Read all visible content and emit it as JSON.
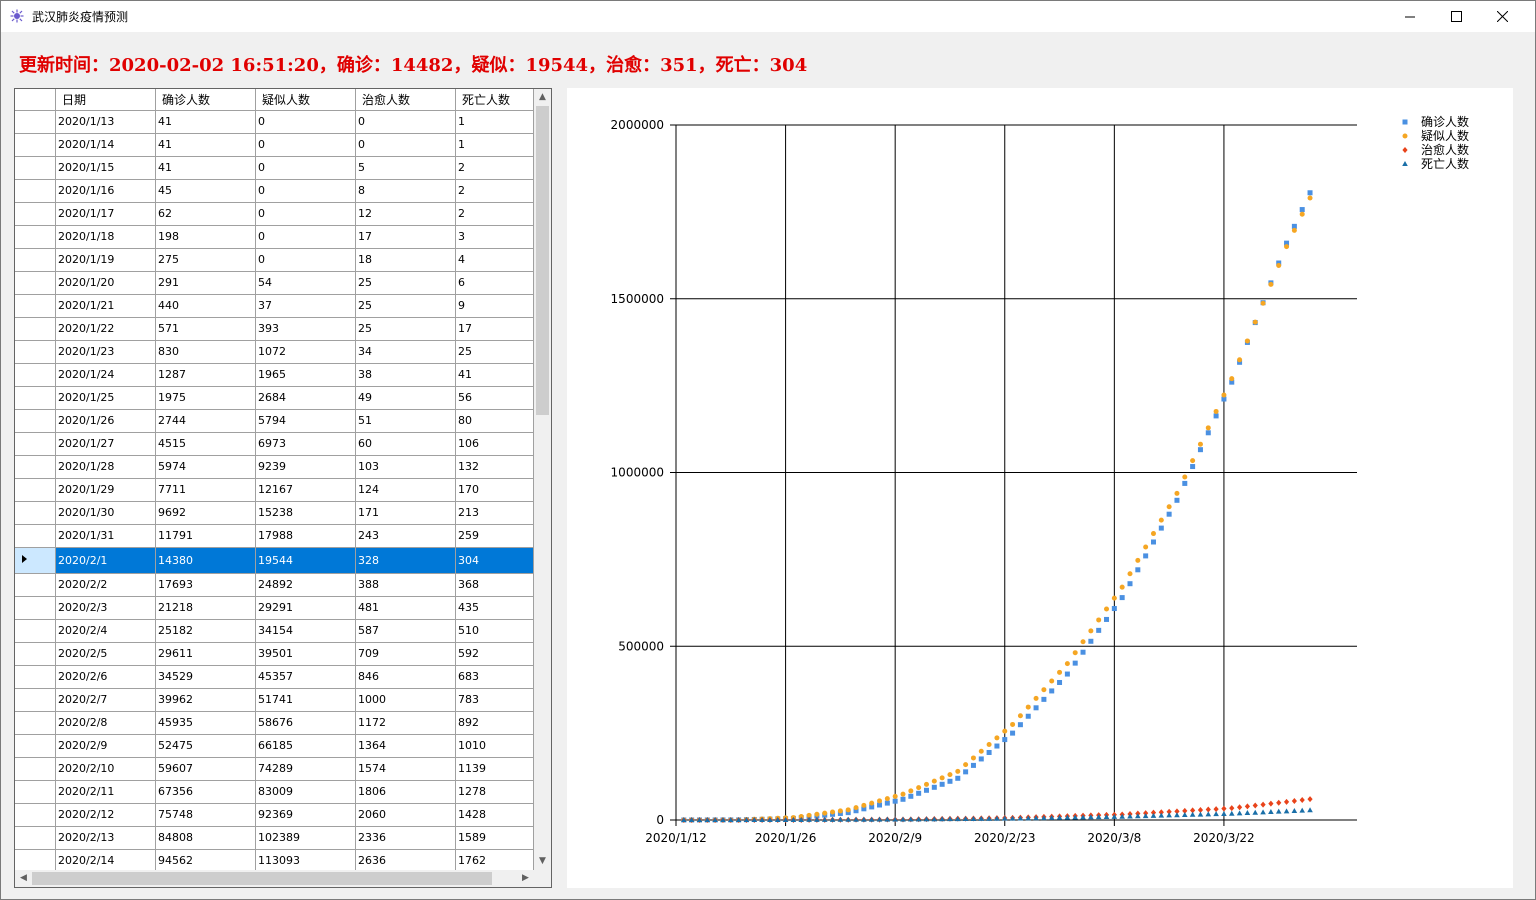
{
  "window": {
    "title": "武汉肺炎疫情预测"
  },
  "status_line": "更新时间：2020-02-02 16:51:20，确诊：14482，疑似：19544，治愈：351，死亡：304",
  "table": {
    "columns": [
      "日期",
      "确诊人数",
      "疑似人数",
      "治愈人数",
      "死亡人数"
    ],
    "selected_row": 19,
    "rows": [
      [
        "2020/1/13",
        "41",
        "0",
        "0",
        "1"
      ],
      [
        "2020/1/14",
        "41",
        "0",
        "0",
        "1"
      ],
      [
        "2020/1/15",
        "41",
        "0",
        "5",
        "2"
      ],
      [
        "2020/1/16",
        "45",
        "0",
        "8",
        "2"
      ],
      [
        "2020/1/17",
        "62",
        "0",
        "12",
        "2"
      ],
      [
        "2020/1/18",
        "198",
        "0",
        "17",
        "3"
      ],
      [
        "2020/1/19",
        "275",
        "0",
        "18",
        "4"
      ],
      [
        "2020/1/20",
        "291",
        "54",
        "25",
        "6"
      ],
      [
        "2020/1/21",
        "440",
        "37",
        "25",
        "9"
      ],
      [
        "2020/1/22",
        "571",
        "393",
        "25",
        "17"
      ],
      [
        "2020/1/23",
        "830",
        "1072",
        "34",
        "25"
      ],
      [
        "2020/1/24",
        "1287",
        "1965",
        "38",
        "41"
      ],
      [
        "2020/1/25",
        "1975",
        "2684",
        "49",
        "56"
      ],
      [
        "2020/1/26",
        "2744",
        "5794",
        "51",
        "80"
      ],
      [
        "2020/1/27",
        "4515",
        "6973",
        "60",
        "106"
      ],
      [
        "2020/1/28",
        "5974",
        "9239",
        "103",
        "132"
      ],
      [
        "2020/1/29",
        "7711",
        "12167",
        "124",
        "170"
      ],
      [
        "2020/1/30",
        "9692",
        "15238",
        "171",
        "213"
      ],
      [
        "2020/1/31",
        "11791",
        "17988",
        "243",
        "259"
      ],
      [
        "2020/2/1",
        "14380",
        "19544",
        "328",
        "304"
      ],
      [
        "2020/2/2",
        "17693",
        "24892",
        "388",
        "368"
      ],
      [
        "2020/2/3",
        "21218",
        "29291",
        "481",
        "435"
      ],
      [
        "2020/2/4",
        "25182",
        "34154",
        "587",
        "510"
      ],
      [
        "2020/2/5",
        "29611",
        "39501",
        "709",
        "592"
      ],
      [
        "2020/2/6",
        "34529",
        "45357",
        "846",
        "683"
      ],
      [
        "2020/2/7",
        "39962",
        "51741",
        "1000",
        "783"
      ],
      [
        "2020/2/8",
        "45935",
        "58676",
        "1172",
        "892"
      ],
      [
        "2020/2/9",
        "52475",
        "66185",
        "1364",
        "1010"
      ],
      [
        "2020/2/10",
        "59607",
        "74289",
        "1574",
        "1139"
      ],
      [
        "2020/2/11",
        "67356",
        "83009",
        "1806",
        "1278"
      ],
      [
        "2020/2/12",
        "75748",
        "92369",
        "2060",
        "1428"
      ],
      [
        "2020/2/13",
        "84808",
        "102389",
        "2336",
        "1589"
      ],
      [
        "2020/2/14",
        "94562",
        "113093",
        "2636",
        "1762"
      ]
    ]
  },
  "chart_data": {
    "type": "scatter",
    "x_tick_labels": [
      "2020/1/12",
      "2020/1/26",
      "2020/2/9",
      "2020/2/23",
      "2020/3/8",
      "2020/3/22"
    ],
    "x_range": [
      "2020/1/12",
      "2020/4/8"
    ],
    "y_tick_labels": [
      "0",
      "500000",
      "1000000",
      "1500000",
      "2000000"
    ],
    "ylim": [
      0,
      2000000
    ],
    "grid": true,
    "legend_position": "top-right",
    "series": [
      {
        "name": "确诊人数",
        "marker": "square",
        "color": "#4a90e2",
        "points": [
          [
            "2020/1/13",
            41
          ],
          [
            "2020/1/20",
            291
          ],
          [
            "2020/1/27",
            4515
          ],
          [
            "2020/2/3",
            21218
          ],
          [
            "2020/2/10",
            59607
          ],
          [
            "2020/2/17",
            120000
          ],
          [
            "2020/2/24",
            250000
          ],
          [
            "2020/3/2",
            420000
          ],
          [
            "2020/3/9",
            640000
          ],
          [
            "2020/3/16",
            920000
          ],
          [
            "2020/3/23",
            1260000
          ],
          [
            "2020/3/30",
            1660000
          ],
          [
            "2020/4/2",
            1805000
          ]
        ]
      },
      {
        "name": "疑似人数",
        "marker": "circle",
        "color": "#f5a623",
        "points": [
          [
            "2020/1/13",
            0
          ],
          [
            "2020/1/20",
            54
          ],
          [
            "2020/1/27",
            6973
          ],
          [
            "2020/2/3",
            29291
          ],
          [
            "2020/2/10",
            74289
          ],
          [
            "2020/2/17",
            140000
          ],
          [
            "2020/2/24",
            275000
          ],
          [
            "2020/3/2",
            450000
          ],
          [
            "2020/3/9",
            670000
          ],
          [
            "2020/3/16",
            940000
          ],
          [
            "2020/3/23",
            1270000
          ],
          [
            "2020/3/30",
            1650000
          ],
          [
            "2020/4/2",
            1790000
          ]
        ]
      },
      {
        "name": "治愈人数",
        "marker": "diamond",
        "color": "#e8431a",
        "points": [
          [
            "2020/1/13",
            0
          ],
          [
            "2020/1/27",
            60
          ],
          [
            "2020/2/10",
            1574
          ],
          [
            "2020/2/24",
            6000
          ],
          [
            "2020/3/9",
            16000
          ],
          [
            "2020/3/23",
            34000
          ],
          [
            "2020/4/2",
            60000
          ]
        ]
      },
      {
        "name": "死亡人数",
        "marker": "triangle",
        "color": "#1a6fa8",
        "points": [
          [
            "2020/1/13",
            1
          ],
          [
            "2020/1/27",
            106
          ],
          [
            "2020/2/10",
            1139
          ],
          [
            "2020/2/24",
            4000
          ],
          [
            "2020/3/9",
            9500
          ],
          [
            "2020/3/23",
            18000
          ],
          [
            "2020/4/2",
            28000
          ]
        ]
      }
    ]
  }
}
